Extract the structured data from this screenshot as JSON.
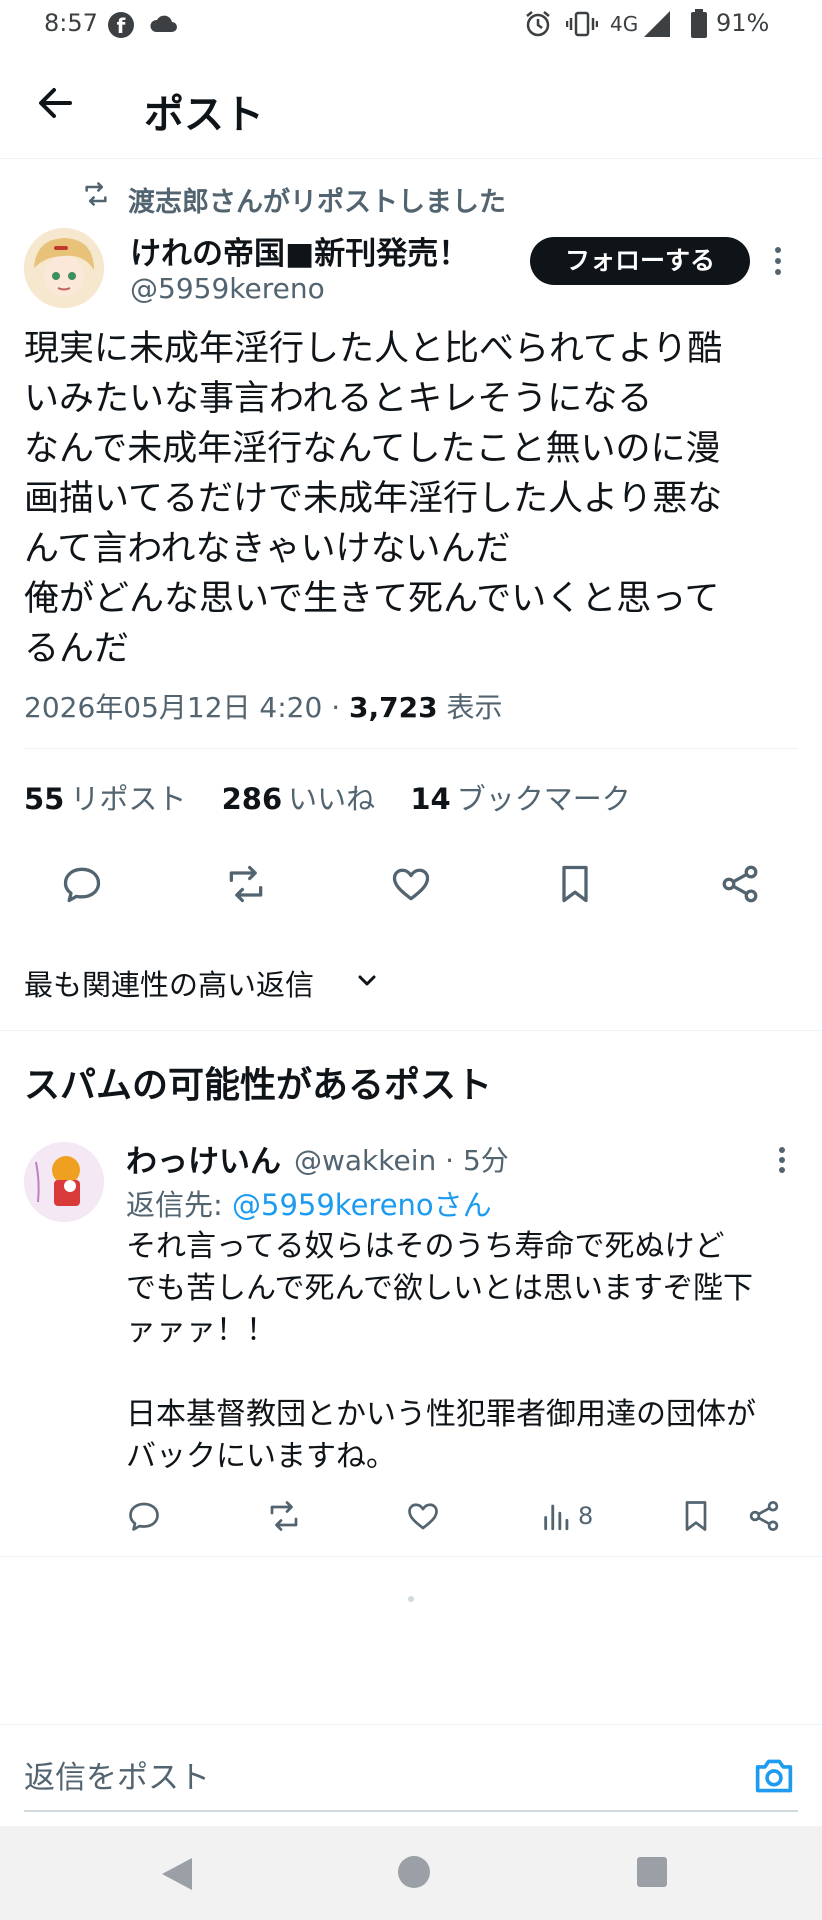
{
  "status_bar": {
    "time": "8:57",
    "network": "4G",
    "battery": "91%"
  },
  "header": {
    "title": "ポスト"
  },
  "repost_banner": "渡志郎さんがリポストしました",
  "author": {
    "name": "けれの帝国■新刊発売！",
    "handle": "@5959kereno"
  },
  "follow_label": "フォローする",
  "tweet": {
    "text": "現実に未成年淫行した人と比べられてより酷\nいみたいな事言われるとキレそうになる\nなんで未成年淫行なんてしたこと無いのに漫\n画描いてるだけで未成年淫行した人より悪な\nんて言われなきゃいけないんだ\n俺がどんな思いで生きて死んでいくと思って\nるんだ",
    "date": "2026年05月12日 4:20",
    "views": "3,723",
    "views_label": "表示"
  },
  "stats": {
    "reposts": "55",
    "reposts_label": "リポスト",
    "likes": "286",
    "likes_label": "いいね",
    "bookmarks": "14",
    "bookmarks_label": "ブックマーク"
  },
  "sort": {
    "label": "最も関連性の高い返信"
  },
  "section_title": "スパムの可能性があるポスト",
  "reply": {
    "name": "わっけいん",
    "handle_time": "@wakkein · 5分",
    "reply_to_prefix": "返信先: ",
    "reply_to_link": "@5959kerenoさん",
    "text": "それ言ってる奴らはそのうち寿命で死ぬけど\nでも苦しんで死んで欲しいとは思いますぞ陛下\nァァァ！！\n\n日本基督教団とかいう性犯罪者御用達の団体が\nバックにいますね。",
    "views": "8"
  },
  "compose": {
    "placeholder": "返信をポスト"
  },
  "icons": {
    "status": [
      "facebook-icon",
      "cloud-icon",
      "alarm-icon",
      "vibrate-icon",
      "signal-icon",
      "battery-icon"
    ],
    "actions": [
      "reply-icon",
      "repost-icon",
      "like-icon",
      "bookmark-icon",
      "share-icon"
    ],
    "reply_actions": [
      "reply-icon",
      "repost-icon",
      "like-icon",
      "views-icon",
      "bookmark-icon",
      "share-icon"
    ]
  },
  "colors": {
    "accent": "#1d9bf0",
    "text": "#0f1419",
    "muted": "#536471",
    "follow_bg": "#0f1419"
  }
}
